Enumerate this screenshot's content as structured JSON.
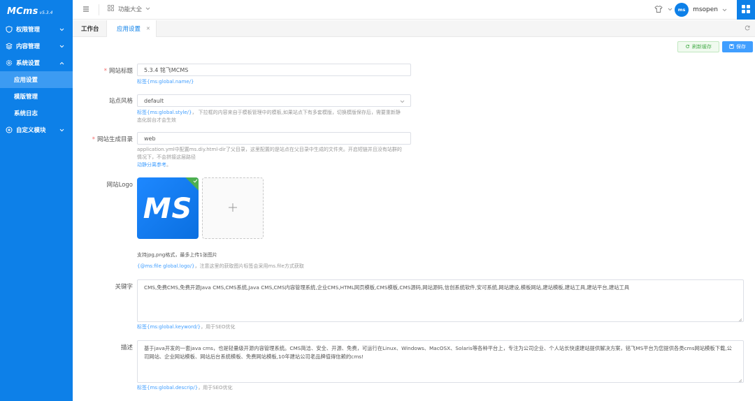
{
  "app": {
    "logo_text": "MCms",
    "version": "v5.3.4"
  },
  "sidebar": {
    "groups": [
      {
        "label": "权限管理",
        "icon": "shield-icon"
      },
      {
        "label": "内容管理",
        "icon": "layers-icon"
      },
      {
        "label": "系统设置",
        "icon": "gear-icon"
      },
      {
        "label": "自定义模块",
        "icon": "plus-circle-icon"
      }
    ],
    "sub_items": [
      {
        "label": "应用设置"
      },
      {
        "label": "模版管理"
      },
      {
        "label": "系统日志"
      }
    ]
  },
  "header": {
    "menu_label": "功能大全",
    "user_avatar": "ms",
    "username": "msopen"
  },
  "tabs": [
    {
      "label": "工作台"
    },
    {
      "label": "应用设置"
    }
  ],
  "toolbar": {
    "refresh_label": "刷新缓存",
    "save_label": "保存"
  },
  "form": {
    "site_title": {
      "label": "网站标题",
      "value": "5.3.4 铭飞MCMS",
      "hint_tag": "标签{ms:global.name/}"
    },
    "site_style": {
      "label": "站点风格",
      "value": "default",
      "hint_tag": "标签{ms:global.style/}",
      "hint_text": "， 下拉框的内容来自于模板管理中的模板,如果站点下有多套模版，切换模版保存后，需要重新静",
      "hint_text2": "态化前台才会生效"
    },
    "gen_dir": {
      "label": "网站生成目录",
      "value": "web",
      "hint_line1": "application.yml中配置ms.diy.html-dir了父目录，这里配置的是站点在父目录中生成的文件夹。开启短链并且没有站群的",
      "hint_line2": "情况下，不会拼接这层路径",
      "hint_link": "动静分离参考",
      "hint_link_suffix": "。"
    },
    "site_logo": {
      "label": "网站Logo",
      "logo_text": "MS",
      "hint_line1": "支持jpg,png格式，最多上传1张图片",
      "hint_tag": "{@ms:file global.logo/}",
      "hint_text": "，注意这里的获取图片标签会采用ms.file方式获取"
    },
    "keywords": {
      "label": "关键字",
      "value": "CMS,免费CMS,免费开源Java CMS,CMS系统,Java CMS,CMS内容管理系统,企业CMS,HTML网页模板,CMS模板,CMS源码,网站源码,信创系统软件,安可系统,网站建设,模板网站,建站模板,建站工具,建站平台,建站工具",
      "hint_tag": "标签{ms:global.keyword/}",
      "hint_text": "，用于SEO优化"
    },
    "description": {
      "label": "描述",
      "value": "基于java开发的一套java cms，也是轻量级开源内容管理系统。CMS简洁、安全、开源、免费，可运行在Linux、Windows、MacOSX、Solaris等各种平台上，专注为公司企业、个人站长快速建站提供解决方案，铭飞MS平台为您提供各类cms网站模板下载,公司网站、企业网站模板、网站后台系统模板、免费网站模板,10年建站公司老品牌值得信赖的cms!",
      "hint_tag": "标签{ms:global.descrip/}",
      "hint_text": "，用于SEO优化"
    }
  },
  "colors": {
    "primary": "#0d80e8",
    "accent": "#409eff",
    "success": "#4caf50",
    "required": "#f56c6c"
  }
}
